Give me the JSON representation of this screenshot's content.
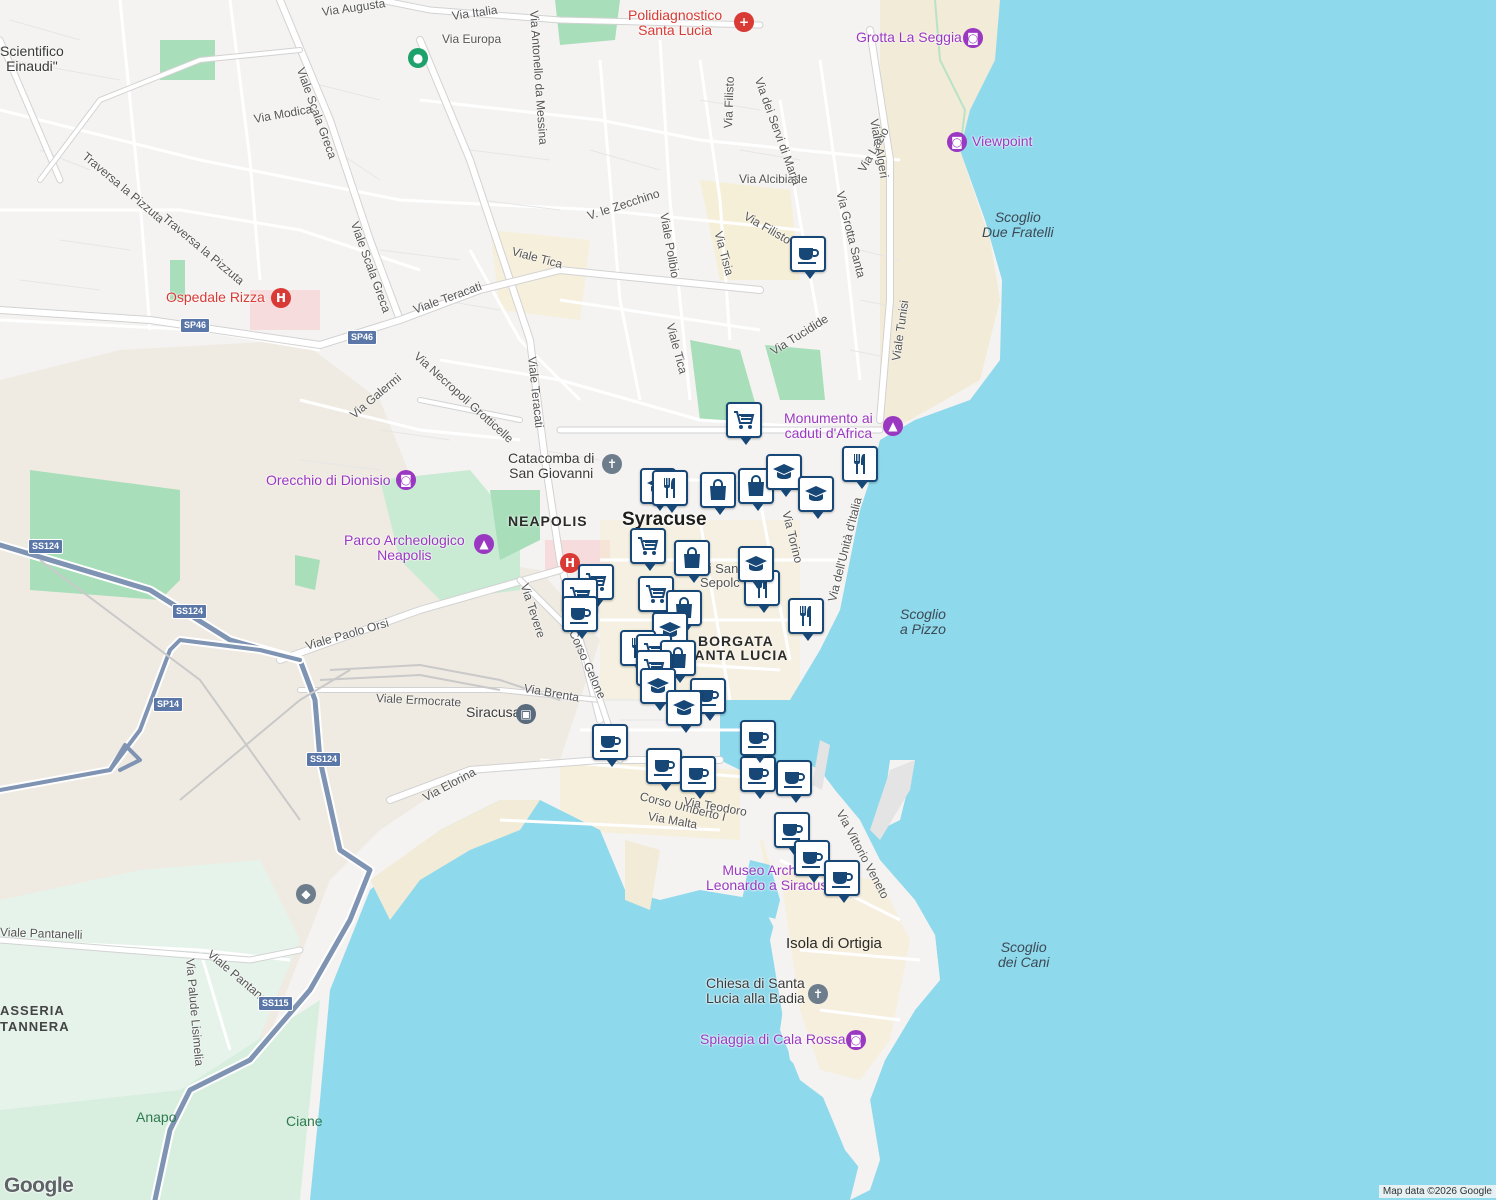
{
  "map": {
    "city_name": "Syracuse",
    "districts": [
      "NEAPOLIS",
      "BORGATA",
      "SANTA LUCIA"
    ],
    "water_labels": [
      "Scoglio\nDue Fratelli",
      "Scoglio\na Pizzo",
      "Scoglio\ndei Cani"
    ],
    "island": "Isola di Ortigia",
    "area_labels": [
      "ASSERIA",
      "TANNERA"
    ],
    "green_labels": [
      "Anapo",
      "Ciane"
    ]
  },
  "pois": {
    "polidiagnostico": "Polidiagnostico\nSanta Lucia",
    "grotta": "Grotta La Seggia",
    "viewpoint": "Viewpoint",
    "ospedale": "Ospedale Rizza",
    "monumento": "Monumento ai\ncaduti d'Africa",
    "catacomba": "Catacomba di\nSan Giovanni",
    "orecchio": "Orecchio di Dionisio",
    "parco": "Parco Archeologico\nNeapolis",
    "siracusa_station": "Siracusa",
    "museo": "Museo Archim\nLeonardo a Siracus",
    "chiesa": "Chiesa di Santa\nLucia alla Badia",
    "spiaggia": "Spiaggia di Cala Rossa",
    "scientifico": "Scientifico\nEinaudi\"",
    "sepolcro": "di San\nSepolc"
  },
  "streets": {
    "via_augusta": "Via Augusta",
    "via_italia": "Via Italia",
    "via_europa": "Via Europa",
    "via_antonello": "Via Antonello da Messina",
    "viale_scala_greca_1": "Viale Scala Greca",
    "viale_scala_greca_2": "Viale Scala Greca",
    "via_modica": "Via Modica",
    "traversa_1": "Traversa la Pizzuta",
    "traversa_2": "Traversa la Pizzuta",
    "viale_tica_1": "Viale Tica",
    "viale_tica_2": "Viale Tica",
    "viale_teracati_1": "Viale Teracati",
    "viale_teracati_2": "Viale Teracati",
    "via_necropoli": "Via Necropoli Grotticelle",
    "via_galermi": "Via Galermi",
    "via_zecchino": "V. le Zecchino",
    "viale_polibio": "Viale Polibio",
    "via_tisia": "Via Tisia",
    "via_filisto_1": "Via Filisto",
    "via_filisto_2": "Via Filisto",
    "via_alcibiade": "Via Alcibiade",
    "via_servi": "Via dei Servi di Maria",
    "via_lazio": "Via Lazio",
    "via_grotta_santa": "Via Grotta Santa",
    "viale_algeri": "Viale Algeri",
    "viale_tunisi": "Viale Tunisi",
    "via_tucidide": "Via Tucidide",
    "via_torino": "Via Torino",
    "via_unita": "Via dell'Unità d'Italia",
    "viale_paolo_orsi": "Viale Paolo Orsi",
    "via_tevere": "Via Tevere",
    "corso_gelone": "Corso Gelone",
    "viale_ermocrate": "Viale Ermocrate",
    "via_brenta": "Via Brenta",
    "via_elorina": "Via Elorina",
    "corso_umberto": "Corso Umberto I",
    "via_malta": "Via Malta",
    "via_veneto": "Via Vittorio Veneto",
    "via_teodoro": "Via Teodoro",
    "viale_pantanelli_1": "Viale Pantanelli",
    "viale_pantanelli_2": "Viale Pantanelli",
    "via_paludi": "Via Palude Lisimelia"
  },
  "shields": {
    "sp46_a": "SP46",
    "sp46_b": "SP46",
    "ss124_a": "SS124",
    "ss124_b": "SS124",
    "ss124_c": "SS124",
    "sp14": "SP14",
    "ss115": "SS115"
  },
  "footer": {
    "logo": "Google",
    "attribution": "Map data ©2026 Google"
  },
  "colors": {
    "sea": "#8fd9ec",
    "land": "#f4f3f1",
    "park": "#9fdab1",
    "pin_border": "#174777",
    "purple_poi": "#9b38c2",
    "red_poi": "#d93a35"
  },
  "markers": [
    "coffee",
    "shopping-cart",
    "restaurant",
    "education",
    "shopping-bag",
    "shopping-bag",
    "education",
    "education",
    "restaurant",
    "restaurant",
    "education",
    "shopping-cart",
    "shopping-bag",
    "shopping-cart",
    "shopping-cart",
    "shopping-cart",
    "coffee",
    "shopping-bag",
    "education",
    "restaurant",
    "restaurant",
    "shopping-cart",
    "shopping-bag",
    "shopping-cart",
    "education",
    "coffee",
    "education",
    "coffee",
    "coffee",
    "coffee",
    "coffee",
    "coffee",
    "coffee",
    "coffee",
    "coffee",
    "coffee"
  ]
}
